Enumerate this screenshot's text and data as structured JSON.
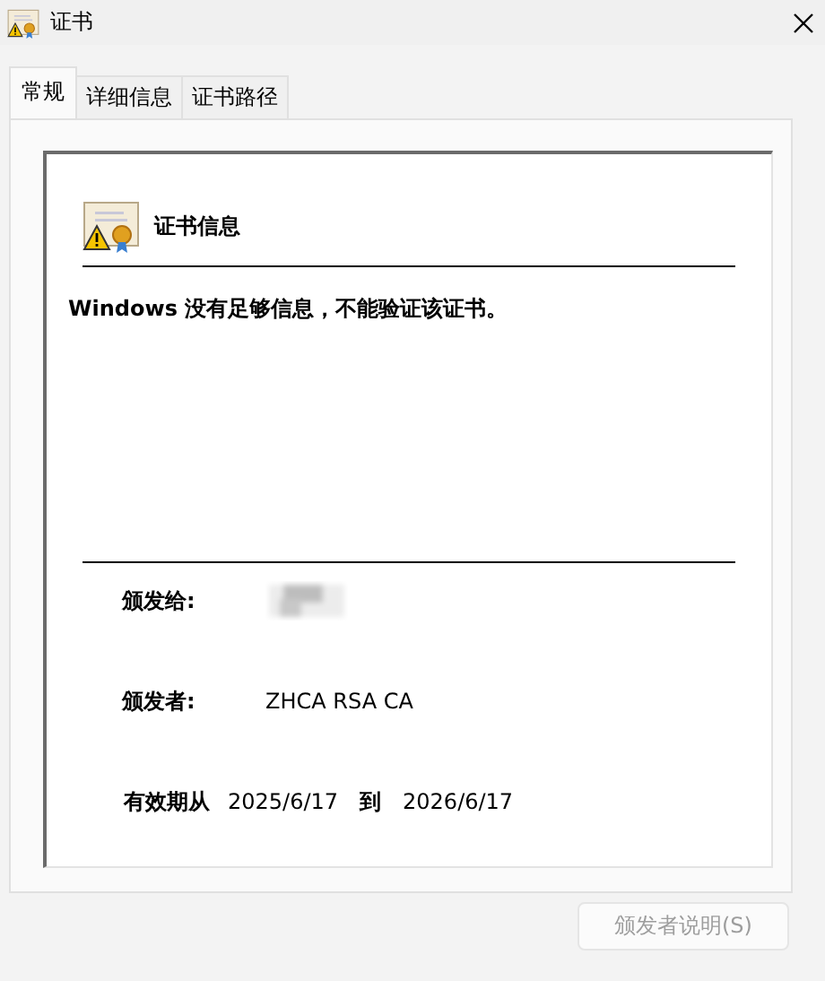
{
  "window": {
    "title": "证书"
  },
  "tabs": [
    {
      "label": "常规",
      "selected": true
    },
    {
      "label": "详细信息",
      "selected": false
    },
    {
      "label": "证书路径",
      "selected": false
    }
  ],
  "heading": "证书信息",
  "message": "Windows 没有足够信息，不能验证该证书。",
  "issued_to": {
    "label": "颁发给:"
  },
  "issued_by": {
    "label": "颁发者:",
    "value": "ZHCA RSA CA"
  },
  "validity": {
    "from_label": "有效期从",
    "from": "2025/6/17",
    "to_label": "到",
    "to": "2026/6/17"
  },
  "button": {
    "label": "颁发者说明(S)",
    "disabled": true
  }
}
